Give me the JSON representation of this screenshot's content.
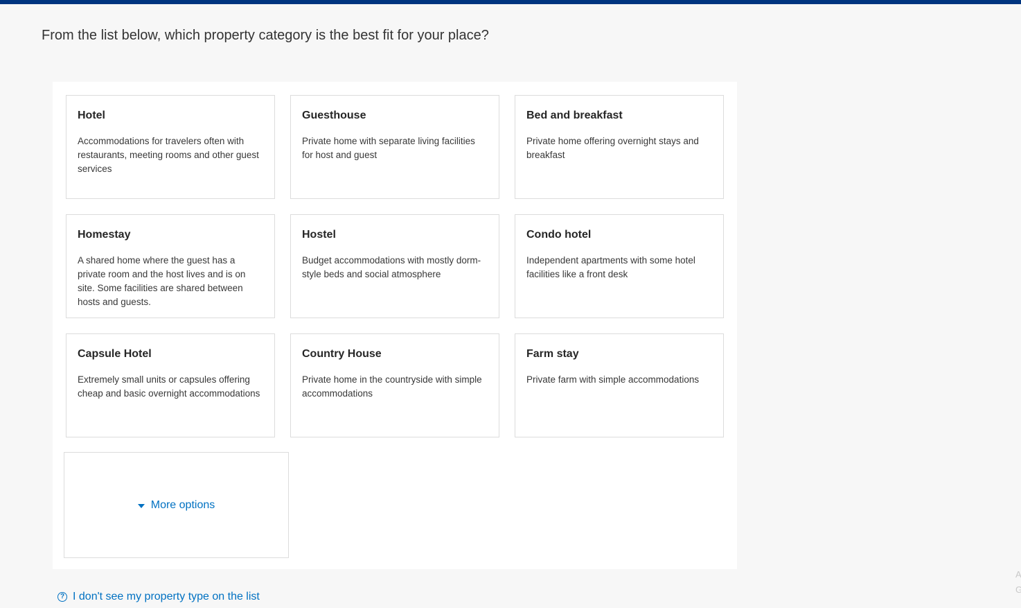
{
  "question": "From the list below, which property category is the best fit for your place?",
  "categories": [
    {
      "title": "Hotel",
      "description": "Accommodations for travelers often with restaurants, meeting rooms and other guest services"
    },
    {
      "title": "Guesthouse",
      "description": "Private home with separate living facilities for host and guest"
    },
    {
      "title": "Bed and breakfast",
      "description": "Private home offering overnight stays and breakfast"
    },
    {
      "title": "Homestay",
      "description": "A shared home where the guest has a private room and the host lives and is on site. Some facilities are shared between hosts and guests."
    },
    {
      "title": "Hostel",
      "description": "Budget accommodations with mostly dorm-style beds and social atmosphere"
    },
    {
      "title": "Condo hotel",
      "description": "Independent apartments with some hotel facilities like a front desk"
    },
    {
      "title": "Capsule Hotel",
      "description": "Extremely small units or capsules offering cheap and basic overnight accommodations"
    },
    {
      "title": "Country House",
      "description": "Private home in the countryside with simple accommodations"
    },
    {
      "title": "Farm stay",
      "description": "Private farm with simple accommodations"
    }
  ],
  "more_options_label": "More options",
  "help_link_label": "I don't see my property type on the list",
  "edge_text": {
    "line1": "A",
    "line2": "G"
  },
  "colors": {
    "brand_bar": "#003580",
    "link": "#0071c2",
    "card_border": "#dcdcdc",
    "page_bg": "#f7f7f7"
  },
  "icons": {
    "more_options": "caret-down-icon",
    "help": "question-circle-icon"
  }
}
